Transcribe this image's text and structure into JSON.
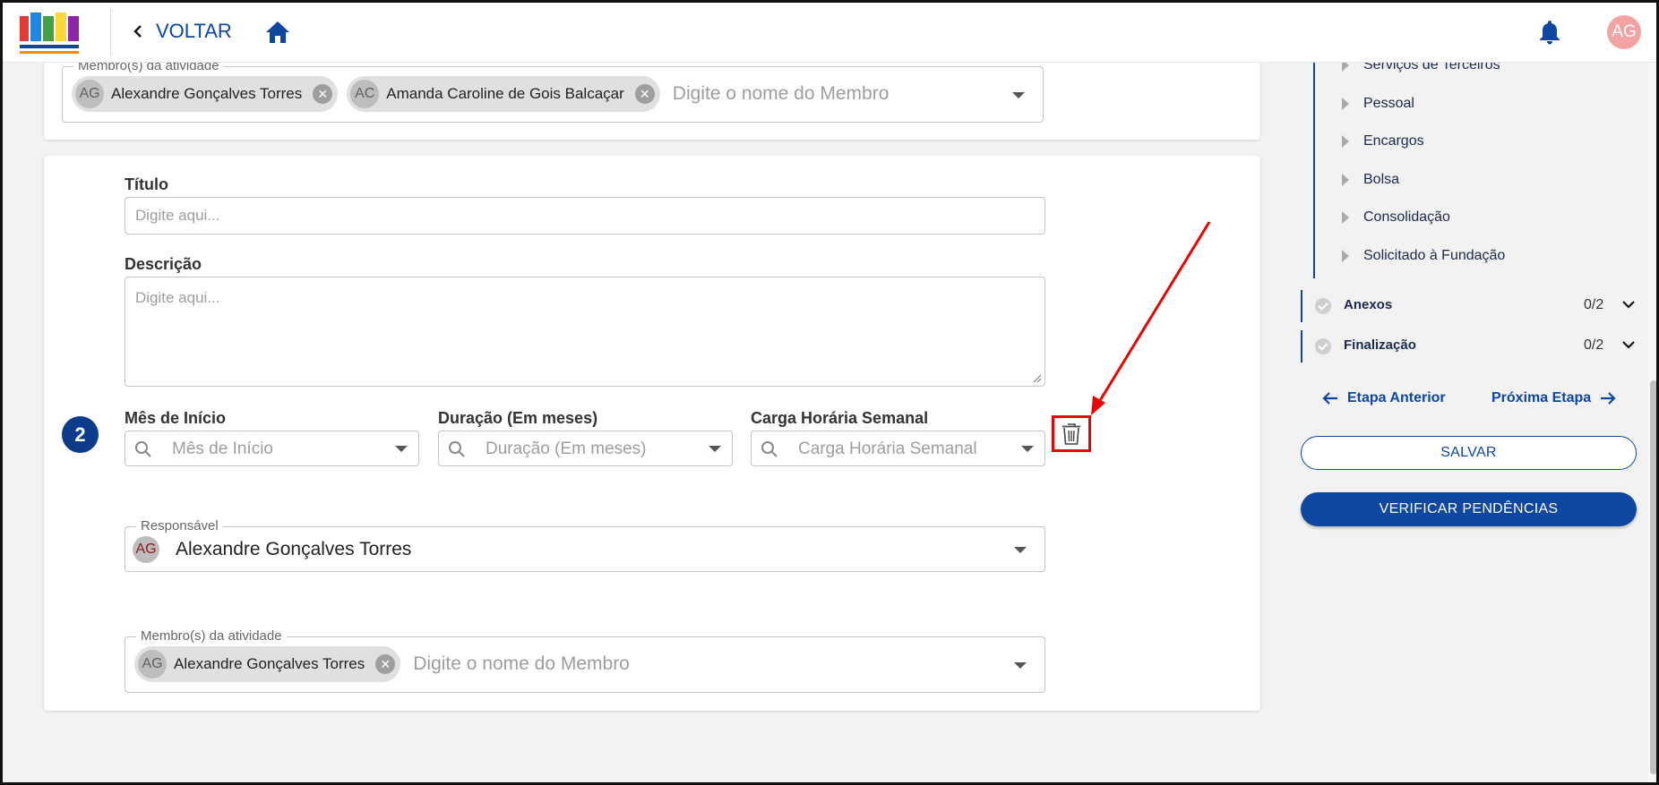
{
  "header": {
    "back_label": "VOLTAR",
    "avatar_initials": "AG"
  },
  "top_card": {
    "members_legend": "Membro(s) da atividade",
    "members": [
      {
        "initials": "AG",
        "name": "Alexandre Gonçalves Torres"
      },
      {
        "initials": "AC",
        "name": "Amanda Caroline de Gois Balcaçar"
      }
    ],
    "members_placeholder": "Digite o nome do Membro"
  },
  "activity": {
    "step_number": "2",
    "title_label": "Título",
    "title_placeholder": "Digite aqui...",
    "description_label": "Descrição",
    "description_placeholder": "Digite aqui...",
    "start_month_label": "Mês de Início",
    "start_month_placeholder": "Mês de Início",
    "duration_label": "Duração (Em meses)",
    "duration_placeholder": "Duração (Em meses)",
    "weekly_hours_label": "Carga Horária Semanal",
    "weekly_hours_placeholder": "Carga Horária Semanal",
    "responsible_legend": "Responsável",
    "responsible": {
      "initials": "AG",
      "name": "Alexandre Gonçalves Torres"
    },
    "members_legend": "Membro(s) da atividade",
    "members": [
      {
        "initials": "AG",
        "name": "Alexandre Gonçalves Torres"
      }
    ],
    "members_placeholder": "Digite o nome do Membro"
  },
  "sidebar": {
    "sub_items": [
      "Serviços de Terceiros",
      "Pessoal",
      "Encargos",
      "Bolsa",
      "Consolidação",
      "Solicitado à Fundação"
    ],
    "sections": [
      {
        "name": "Anexos",
        "count": "0/2"
      },
      {
        "name": "Finalização",
        "count": "0/2"
      }
    ],
    "prev_label": "Etapa Anterior",
    "next_label": "Próxima Etapa",
    "save_label": "SALVAR",
    "verify_label": "VERIFICAR PENDÊNCIAS"
  },
  "colors": {
    "primary": "#0d47a1",
    "step_badge": "#0d3b8c",
    "highlight": "#e00000",
    "avatar_top": "#f4a3a3"
  }
}
